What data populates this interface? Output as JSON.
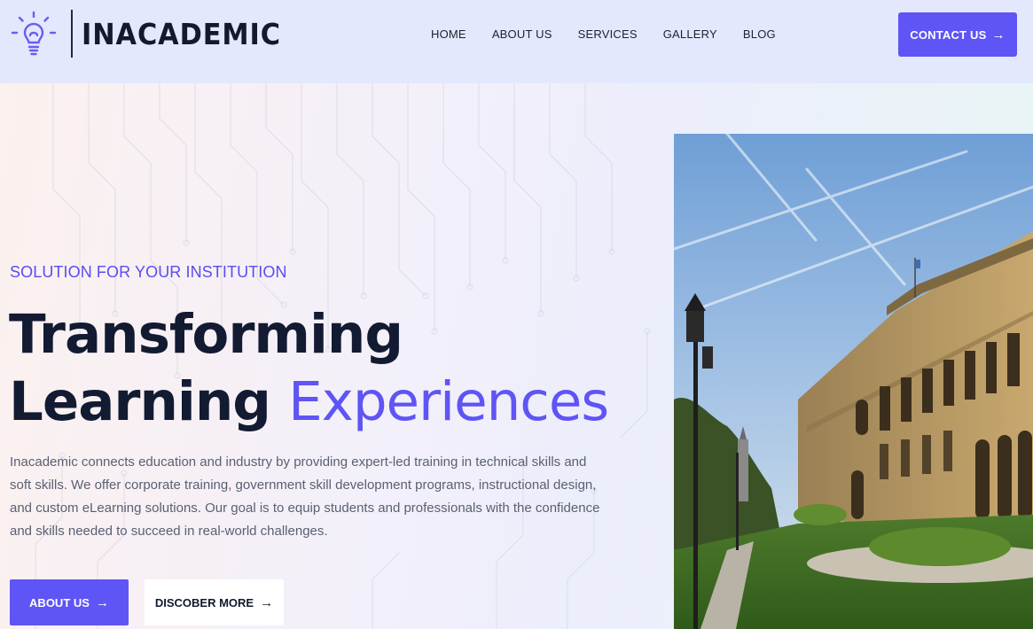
{
  "brand": {
    "name": "INACADEMIC",
    "icon": "lightbulb-icon"
  },
  "nav": {
    "items": [
      {
        "label": "HOME"
      },
      {
        "label": "ABOUT US"
      },
      {
        "label": "SERVICES"
      },
      {
        "label": "GALLERY"
      },
      {
        "label": "BLOG"
      }
    ],
    "cta": {
      "label": "CONTACT US",
      "icon": "arrow-right-icon"
    }
  },
  "hero": {
    "eyebrow": "SOLUTION FOR YOUR INSTITUTION",
    "headline_line1": "Transforming",
    "headline_line2_bold": "Learning",
    "headline_line2_accent": "Experiences",
    "description": "Inacademic connects education and industry by providing expert-led training in technical skills and soft skills. We offer corporate training, government skill development programs, instructional design, and custom eLearning solutions. Our goal is to equip students and professionals with the confidence and skills needed to succeed in real-world challenges.",
    "primary_button": {
      "label": "ABOUT US",
      "icon": "arrow-right-icon"
    },
    "secondary_button": {
      "label": "DISCOBER MORE",
      "icon": "arrow-right-icon"
    },
    "image": "campus-building-photo"
  },
  "colors": {
    "accent": "#5f54f5",
    "header_bg": "#e3e8fd",
    "heading": "#131b32",
    "body_text": "#5a6072"
  }
}
